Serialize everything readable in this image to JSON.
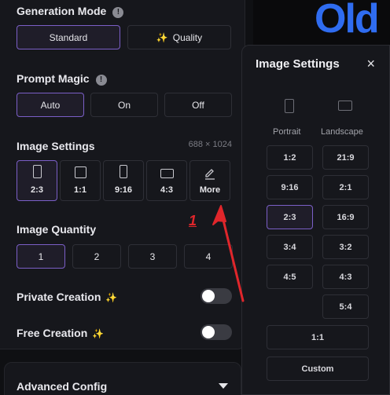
{
  "generation_mode": {
    "title": "Generation Mode",
    "options": [
      "Standard",
      "Quality"
    ],
    "selected": "Standard"
  },
  "prompt_magic": {
    "title": "Prompt Magic",
    "options": [
      "Auto",
      "On",
      "Off"
    ],
    "selected": "Auto"
  },
  "image_settings": {
    "title": "Image Settings",
    "dimensions": "688 × 1024",
    "ratios": [
      "2:3",
      "1:1",
      "9:16",
      "4:3",
      "More"
    ],
    "selected": "2:3"
  },
  "image_quantity": {
    "title": "Image Quantity",
    "options": [
      "1",
      "2",
      "3",
      "4"
    ],
    "selected": "1"
  },
  "private_creation": {
    "label": "Private Creation",
    "enabled": false
  },
  "free_creation": {
    "label": "Free Creation",
    "enabled": false
  },
  "advanced_config": {
    "label": "Advanced Config"
  },
  "background": {
    "text": "Old"
  },
  "popup": {
    "title": "Image Settings",
    "close": "×",
    "portrait_label": "Portrait",
    "landscape_label": "Landscape",
    "portrait_ratios": [
      "1:2",
      "9:16",
      "2:3",
      "3:4",
      "4:5"
    ],
    "landscape_ratios": [
      "21:9",
      "2:1",
      "16:9",
      "3:2",
      "4:3",
      "5:4"
    ],
    "square": "1:1",
    "custom": "Custom",
    "selected": "2:3"
  },
  "annotation": {
    "number": "1"
  },
  "colors": {
    "accent": "#7b5fc7",
    "annotation": "#e0262b",
    "brand_text": "#2f6cf0",
    "magic_wand": "#f2c14e"
  }
}
